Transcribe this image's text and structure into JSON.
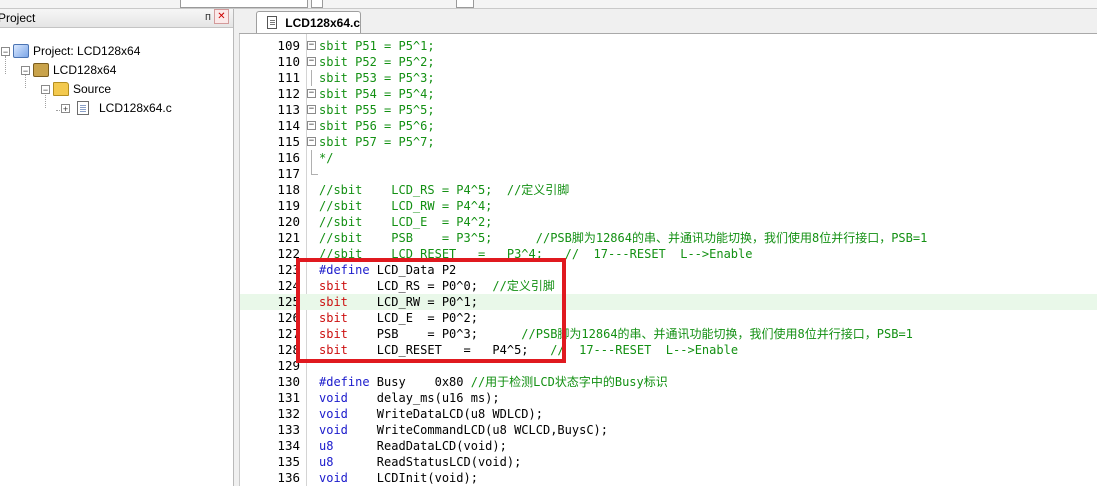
{
  "project_panel": {
    "title": "Project",
    "pin_glyph": "ᴨ",
    "close_glyph": "✕",
    "tree": [
      {
        "label": "Project: LCD128x64",
        "expander": "−",
        "icon": "project-icon"
      },
      {
        "label": "LCD128x64",
        "expander": "−",
        "icon": "target-icon"
      },
      {
        "label": "Source",
        "expander": "−",
        "icon": "folder-icon"
      },
      {
        "label": "LCD128x64.c",
        "expander": "+",
        "icon": "c-file-icon"
      }
    ]
  },
  "editor": {
    "tab_label": "LCD128x64.c",
    "highlight_color": "#e9f8e9",
    "annotation_box_color": "#e0191f",
    "lines": [
      {
        "num": "109",
        "fold": "−",
        "text": "sbit P51 = P5^1;",
        "style": "green"
      },
      {
        "num": "110",
        "fold": "−",
        "text": "sbit P52 = P5^2;",
        "style": "green"
      },
      {
        "num": "111",
        "fold": "",
        "text": "sbit P53 = P5^3;",
        "style": "green"
      },
      {
        "num": "112",
        "fold": "−",
        "text": "sbit P54 = P5^4;",
        "style": "green"
      },
      {
        "num": "113",
        "fold": "−",
        "text": "sbit P55 = P5^5;",
        "style": "green"
      },
      {
        "num": "114",
        "fold": "−",
        "text": "sbit P56 = P5^6;",
        "style": "green"
      },
      {
        "num": "115",
        "fold": "−",
        "text": "sbit P57 = P5^7;",
        "style": "green"
      },
      {
        "num": "116",
        "fold": "",
        "text": "*/",
        "style": "green"
      },
      {
        "num": "117",
        "fold": "",
        "text": "",
        "style": "green"
      },
      {
        "num": "118",
        "fold": "",
        "text": "//sbit    LCD_RS = P4^5;  //定义引脚",
        "style": "green"
      },
      {
        "num": "119",
        "fold": "",
        "text": "//sbit    LCD_RW = P4^4;",
        "style": "green"
      },
      {
        "num": "120",
        "fold": "",
        "text": "//sbit    LCD_E  = P4^2;",
        "style": "green"
      },
      {
        "num": "121",
        "fold": "",
        "text": "//sbit    PSB    = P3^5;      //PSB脚为12864的串、并通讯功能切换，我们使用8位并行接口，PSB=1",
        "style": "green"
      },
      {
        "num": "122",
        "fold": "",
        "text": "//sbit    LCD_RESET   =   P3^4;   //  17---RESET  L-->Enable",
        "style": "green"
      },
      {
        "num": "123",
        "fold": "",
        "kw": "#define",
        "rest": " LCD_Data P2",
        "comment": "",
        "style": "define"
      },
      {
        "num": "124",
        "fold": "",
        "kw": "sbit",
        "rest": "    LCD_RS = P0^0;  ",
        "comment": "//定义引脚",
        "style": "sbit"
      },
      {
        "num": "125",
        "fold": "",
        "kw": "sbit",
        "rest": "    LCD_RW = P0^1;",
        "comment": "",
        "style": "sbit",
        "highlight": true
      },
      {
        "num": "126",
        "fold": "",
        "kw": "sbit",
        "rest": "    LCD_E  = P0^2;",
        "comment": "",
        "style": "sbit"
      },
      {
        "num": "127",
        "fold": "",
        "kw": "sbit",
        "rest": "    PSB    = P0^3;      ",
        "comment": "//PSB脚为12864的串、并通讯功能切换，我们使用8位并行接口，PSB=1",
        "style": "sbit"
      },
      {
        "num": "128",
        "fold": "",
        "kw": "sbit",
        "rest": "    LCD_RESET   =   P4^5;   ",
        "comment": "//  17---RESET  L-->Enable",
        "style": "sbit"
      },
      {
        "num": "129",
        "fold": "",
        "text": "",
        "style": "plain"
      },
      {
        "num": "130",
        "fold": "",
        "kw": "#define",
        "rest": " Busy    0x80 ",
        "comment": "//用于检测LCD状态字中的Busy标识",
        "style": "define"
      },
      {
        "num": "131",
        "fold": "",
        "kw": "void",
        "rest": "    delay_ms(u16 ms);",
        "comment": "",
        "style": "void"
      },
      {
        "num": "132",
        "fold": "",
        "kw": "void",
        "rest": "    WriteDataLCD(u8 WDLCD);",
        "comment": "",
        "style": "void"
      },
      {
        "num": "133",
        "fold": "",
        "kw": "void",
        "rest": "    WriteCommandLCD(u8 WCLCD,BuysC);",
        "comment": "",
        "style": "void"
      },
      {
        "num": "134",
        "fold": "",
        "kw": "u8",
        "rest": "      ReadDataLCD(void);",
        "comment": "",
        "style": "plainkw"
      },
      {
        "num": "135",
        "fold": "",
        "kw": "u8",
        "rest": "      ReadStatusLCD(void);",
        "comment": "",
        "style": "plainkw"
      },
      {
        "num": "136",
        "fold": "",
        "kw": "void",
        "rest": "    LCDInit(void);",
        "comment": "",
        "style": "void"
      }
    ]
  }
}
